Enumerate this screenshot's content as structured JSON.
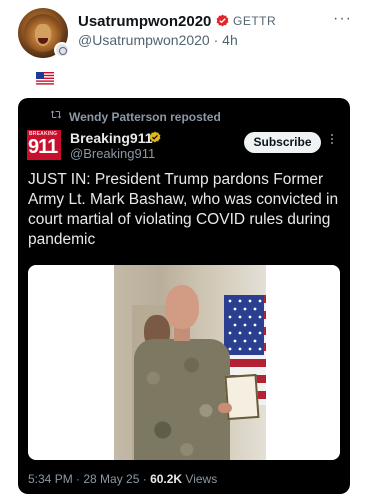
{
  "post": {
    "username": "Usatrumpwon2020",
    "platform": "GETTR",
    "handle_time": "@Usatrumpwon2020 · 4h",
    "more": "···",
    "icons": [
      "avatar-lion",
      "verified-red-icon",
      "flag-us-emoji"
    ]
  },
  "embed": {
    "repost_label": "Wendy Patterson reposted",
    "account_name": "Breaking911",
    "account_handle": "@Breaking911",
    "logo_small": "BREAKING",
    "logo_big": "911",
    "subscribe_label": "Subscribe",
    "text": "JUST IN: President Trump pardons Former Army Lt. Mark Bashaw, who was convicted in court martial of violating COVID rules during pandemic",
    "time_date": "5:34 PM · 28 May 25 · ",
    "views_count": "60.2K",
    "views_label": " Views"
  },
  "colors": {
    "verified_red": "#e0262b",
    "brand_911": "#c8102e",
    "gold_check": "#e2b719",
    "card_bg": "#000000"
  }
}
